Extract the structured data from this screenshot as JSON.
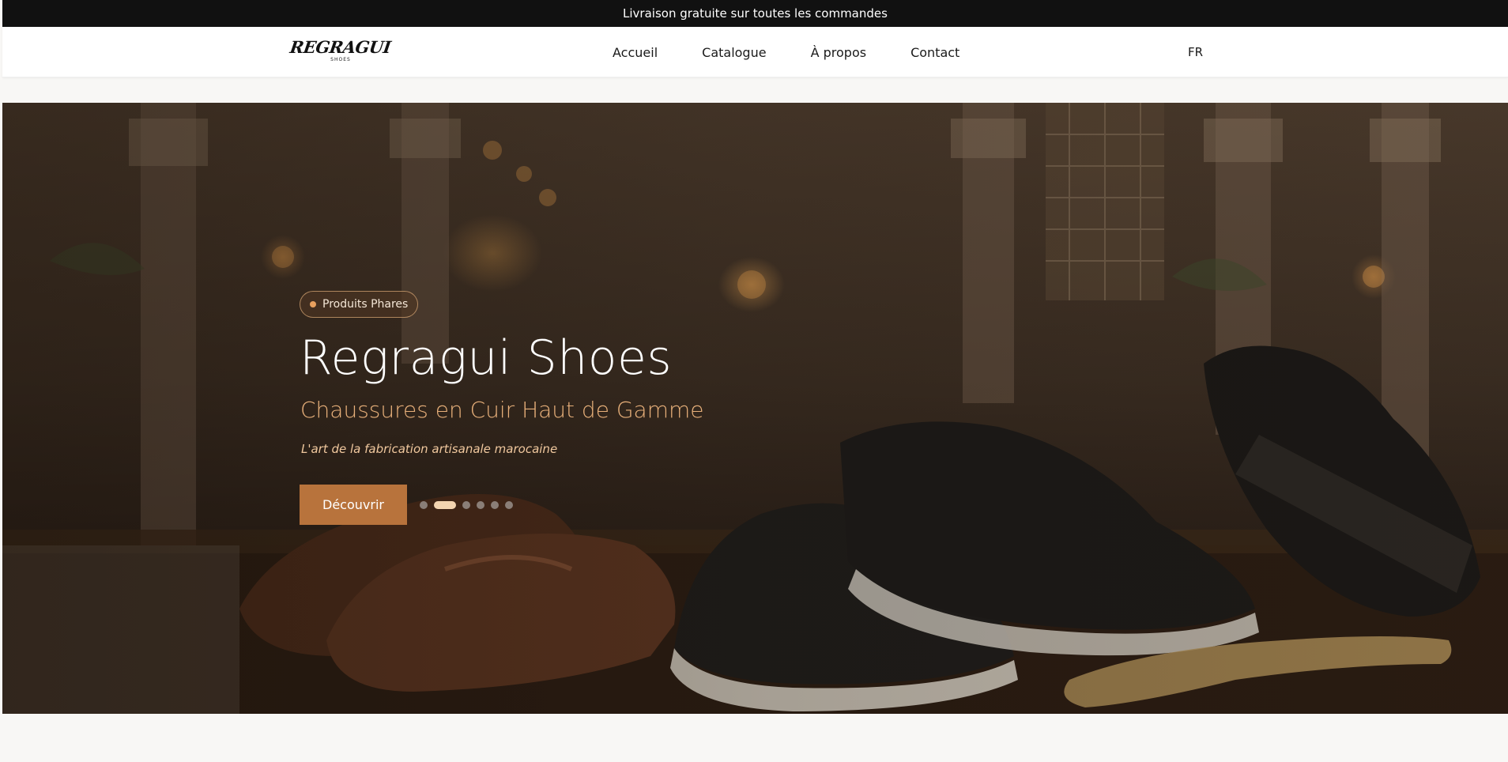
{
  "announcement": {
    "text": "Livraison gratuite sur toutes les commandes"
  },
  "nav": {
    "logo": {
      "word": "REGRAGUI",
      "sub": "SHOES"
    },
    "items": [
      {
        "label": "Accueil"
      },
      {
        "label": "Catalogue"
      },
      {
        "label": "À propos"
      },
      {
        "label": "Contact"
      }
    ],
    "language": "FR"
  },
  "hero": {
    "badge": "Produits Phares",
    "title": "Regragui Shoes",
    "subtitle": "Chaussures en Cuir Haut de Gamme",
    "tagline": "L'art de la fabrication artisanale marocaine",
    "cta_label": "Découvrir",
    "slides_total": 6,
    "active_slide": 2
  },
  "colors": {
    "accent": "#b8733c",
    "subtitle": "#e8b07a",
    "announce_bg": "#111111"
  }
}
